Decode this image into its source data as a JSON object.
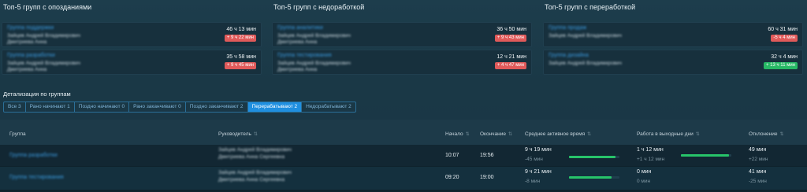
{
  "sections": {
    "late": "Топ-5 групп с опозданиями",
    "underwork": "Топ-5 групп с недоработкой",
    "overwork": "Топ-5 групп с переработкой"
  },
  "cards": {
    "late": [
      {
        "group": "Группа поддержки",
        "person1": "Зайцев Андрей Владимирович",
        "person2": "Дмитриева Анна",
        "time": "46 ч 13 мин",
        "badge": "+ 9 ч 22 мин"
      },
      {
        "group": "Группа разработки",
        "person1": "Зайцев Андрей Владимирович",
        "person2": "Дмитриева Анна",
        "time": "35 ч 58 мин",
        "badge": "+ 9 ч 45 мин"
      }
    ],
    "underwork": [
      {
        "group": "Группа аналитики",
        "person1": "Зайцев Андрей Владимирович",
        "person2": "Дмитриева Анна",
        "time": "36 ч 50 мин",
        "badge": "+ 9 ч 43 мин"
      },
      {
        "group": "Группа тестирования",
        "person1": "Зайцев Андрей Владимирович",
        "person2": "Дмитриева Анна",
        "time": "12 ч 21 мин",
        "badge": "+ 4 ч 47 мин"
      }
    ],
    "overwork": [
      {
        "group": "Группа продаж",
        "person1": "Зайцев Андрей Владимирович",
        "person2": "",
        "time": "60 ч 31 мин",
        "badge": "-5 ч 4 мин"
      },
      {
        "group": "Группа дизайна",
        "person1": "Зайцев Андрей Владимирович",
        "person2": "",
        "time": "32 ч 4 мин",
        "badge": "+ 13 ч 11 мин"
      }
    ]
  },
  "colors": {
    "badge_red": "#e05a5a",
    "badge_green": "#27b865",
    "accent": "#1f8fe0",
    "bar_green": "#27c46a"
  },
  "details": {
    "label": "Детализация по группам",
    "tabs": [
      "Все 3",
      "Рано начинают 1",
      "Поздно начинают 0",
      "Рано заканчивают 0",
      "Поздно заканчивают 2",
      "Перерабатывают 2",
      "Недорабатывают 2"
    ],
    "active_tab": 5
  },
  "table": {
    "columns": [
      "Группа",
      "Руководитель",
      "Начало",
      "Окончание",
      "Среднее активное время",
      "Работа в выходные дни",
      "Отклонение"
    ],
    "rows": [
      {
        "group": "Группа разработки",
        "manager1": "Зайцев Андрей Владимирович",
        "manager2": "Дмитриева Анна Сергеевна",
        "start": "10:07",
        "end": "19:56",
        "avg": "9 ч 19 мин",
        "avg_delta": "-45 мин",
        "avg_fill": 0.92,
        "weekend": "1 ч 12 мин",
        "weekend_delta": "+1 ч 12 мин",
        "weekend_fill": 0.95,
        "dev": "49 мин",
        "dev_delta": "+22 мин"
      },
      {
        "group": "Группа тестирования",
        "manager1": "Зайцев Андрей Владимирович",
        "manager2": "Дмитриева Анна Сергеевна",
        "start": "09:20",
        "end": "19:00",
        "avg": "9 ч 21 мин",
        "avg_delta": "-8 мин",
        "avg_fill": 0.85,
        "weekend": "0 мин",
        "weekend_delta": "0 мин",
        "weekend_fill": 0,
        "dev": "41 мин",
        "dev_delta": "-25 мин"
      }
    ]
  }
}
